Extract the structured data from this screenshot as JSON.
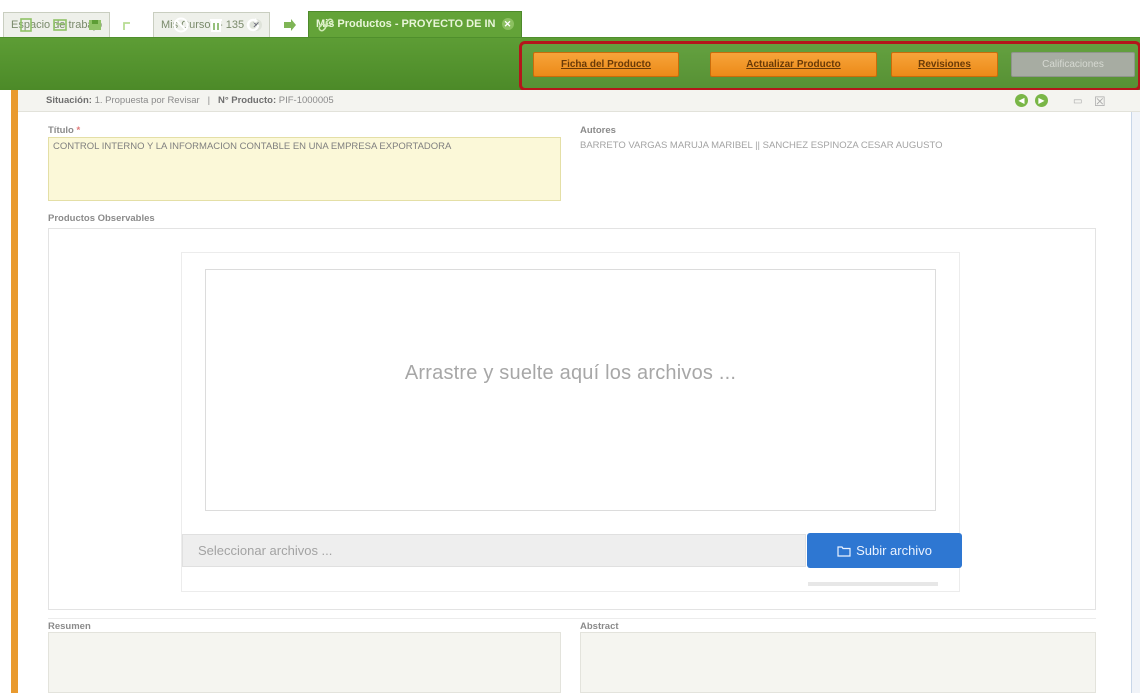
{
  "tabs": [
    {
      "label": "Espacio de trabajo",
      "closable": false,
      "active": false
    },
    {
      "label": "Mis Cursos - 135",
      "closable": true,
      "active": false
    },
    {
      "label": "Mis Productos - PROYECTO DE IN",
      "closable": true,
      "active": true
    }
  ],
  "toolbar": {
    "icons": [
      "new-icon",
      "edit-icon",
      "save-icon",
      "export-icon",
      "cancel-icon",
      "delete-icon",
      "refresh-icon",
      "forward-icon",
      "link-icon"
    ],
    "buttons": {
      "ficha": "Ficha del Producto",
      "actualizar": "Actualizar Producto",
      "revisiones": "Revisiones",
      "calificaciones": "Calificaciones"
    }
  },
  "status": {
    "situacion_label": "Situación:",
    "situacion_value": "1. Propuesta por Revisar",
    "separator": "|",
    "producto_label": "N° Producto:",
    "producto_value": "PIF-1000005"
  },
  "form": {
    "titulo_label": "Título",
    "required_mark": "*",
    "titulo_value": "CONTROL INTERNO Y LA INFORMACION CONTABLE EN UNA EMPRESA EXPORTADORA",
    "autores_label": "Autores",
    "autores_value": "BARRETO VARGAS MARUJA MARIBEL || SANCHEZ ESPINOZA CESAR AUGUSTO",
    "productos_label": "Productos Observables",
    "dropzone_text": "Arrastre y suelte aquí los archivos ...",
    "file_placeholder": "Seleccionar archivos ...",
    "upload_label": "Subir archivo",
    "resumen_label": "Resumen",
    "abstract_label": "Abstract"
  },
  "colors": {
    "toolbar_green": "#5d9d35",
    "highlight_red": "#b4161b",
    "orange_button": "#f29a2a",
    "upload_blue": "#2e77d2"
  }
}
